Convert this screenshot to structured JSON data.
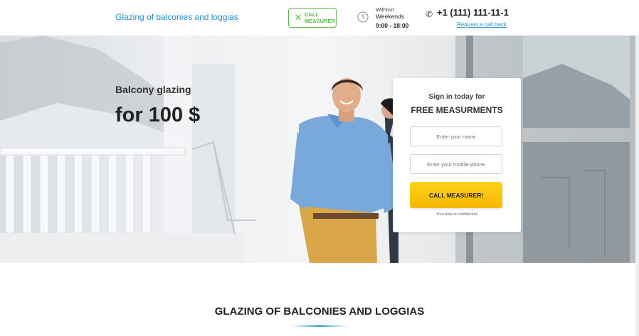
{
  "header": {
    "site_title": "Glazing of balconies and loggias",
    "call_button_label": "CALL MEASURER",
    "hours_label": "Without",
    "hours_prefix": "Weekends",
    "hours_time": "9:00 - 18:00",
    "phone": "+1 (111) 111-11-1",
    "callback_link": "Request a call back"
  },
  "hero": {
    "title": "Balcony glazing",
    "price": "for 100 $"
  },
  "form": {
    "subtitle": "Sign in today for",
    "heading": "FREE MEASURMENTS",
    "name_placeholder": "Enter your name",
    "phone_placeholder": "Enter your mobile phone",
    "submit_label": "CALL MEASURER!",
    "confidential": "Your data is confidential"
  },
  "section": {
    "title": "GLAZING OF BALCONIES AND LOGGIAS"
  },
  "colors": {
    "accent": "#2a8fd0",
    "green": "#5bb84a",
    "cta": "#f5b800"
  }
}
